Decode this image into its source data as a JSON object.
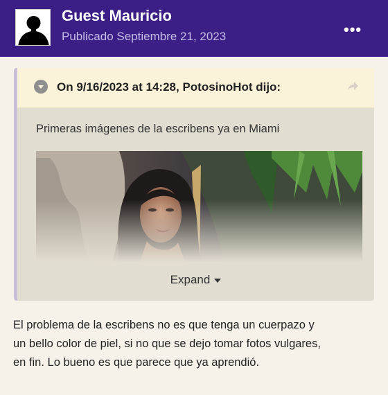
{
  "post": {
    "author": "Guest Mauricio",
    "published": "Publicado Septiembre 21, 2023",
    "more_icon_label": "•••"
  },
  "quote": {
    "citation": "On 9/16/2023 at 14:28, PotosinoHot dijo:",
    "text": "Primeras imágenes de la escribens ya en Miami",
    "expand_label": "Expand"
  },
  "content": {
    "lines": [
      "El problema de la escribens no es que tenga un cuerpazo y",
      "un bello color de piel,  si no que se dejo tomar fotos vulgares,",
      "en fin. Lo bueno es que parece que ya aprendió."
    ]
  },
  "colors": {
    "header_bg": "#3b1f86",
    "quote_head_bg": "#fbf3d9",
    "quote_bg": "#e2ddd1",
    "page_bg": "#f6f2ea"
  },
  "icons": [
    "avatar-placeholder-icon",
    "more-options-icon",
    "quote-toggle-icon",
    "share-icon",
    "expand-caret-icon"
  ]
}
